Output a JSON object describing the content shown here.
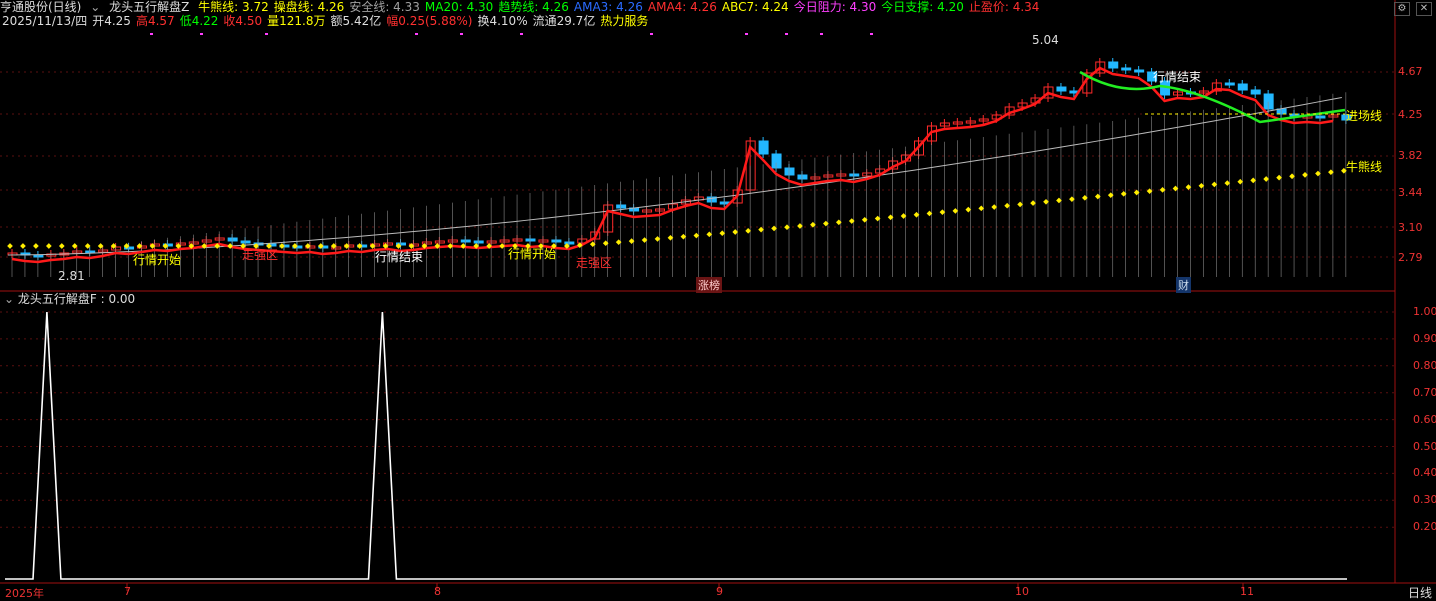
{
  "header": {
    "stock_title": "亨通股份(日线)",
    "indicator_title": "龙头五行解盘Z",
    "items": [
      {
        "label": "牛熊线: 3.72",
        "color": "#ffff00"
      },
      {
        "label": "操盘线: 4.26",
        "color": "#ffff00"
      },
      {
        "label": "安全线: 4.33",
        "color": "#a0a0a0"
      },
      {
        "label": "MA20: 4.30",
        "color": "#00ff00"
      },
      {
        "label": "趋势线: 4.26",
        "color": "#00ff00"
      },
      {
        "label": "AMA3: 4.26",
        "color": "#2a6bff"
      },
      {
        "label": "AMA4: 4.26",
        "color": "#ff3030"
      },
      {
        "label": "ABC7: 4.24",
        "color": "#ffff00"
      },
      {
        "label": "今日阻力: 4.30",
        "color": "#ff40ff"
      },
      {
        "label": "今日支撑: 4.20",
        "color": "#00ff00"
      },
      {
        "label": "止盈价: 4.34",
        "color": "#ff3030"
      }
    ],
    "row2": [
      {
        "label": "2025/11/13/四",
        "color": "#dddddd"
      },
      {
        "label": "开4.25",
        "color": "#dddddd"
      },
      {
        "label": "高4.57",
        "color": "#ff3030"
      },
      {
        "label": "低4.22",
        "color": "#00ff00"
      },
      {
        "label": "收4.50",
        "color": "#ff3030"
      },
      {
        "label": "量121.8万",
        "color": "#ffff00"
      },
      {
        "label": "额5.42亿",
        "color": "#dddddd"
      },
      {
        "label": "幅0.25(5.88%)",
        "color": "#ff3030"
      },
      {
        "label": "换4.10%",
        "color": "#dddddd"
      },
      {
        "label": "流通29.7亿",
        "color": "#dddddd"
      },
      {
        "label": "热力服务",
        "color": "#ffff00"
      }
    ]
  },
  "price_axis": [
    "4.67",
    "4.25",
    "3.82",
    "3.44",
    "3.10",
    "2.79"
  ],
  "price_annotations": {
    "high": "5.04",
    "low": "2.81",
    "start1": "行情开始",
    "end1": "行情结束",
    "start2": "行情开始",
    "end2": "行情结束",
    "strong1": "走强区",
    "strong2": "走强区",
    "entry_line": "进场线",
    "bull_line": "牛熊线",
    "tag_limitup": "涨榜",
    "tag_finance": "财"
  },
  "sub_panel": {
    "title": "龙头五行解盘F : 0.00",
    "axis": [
      "1.00",
      "0.90",
      "0.80",
      "0.70",
      "0.60",
      "0.50",
      "0.40",
      "0.30",
      "0.20"
    ]
  },
  "date_axis": [
    "2025年",
    "7",
    "8",
    "9",
    "10",
    "11"
  ],
  "period_label": "日线",
  "chart_data": {
    "type": "line",
    "title": "龙头五行解盘F",
    "series": [
      {
        "name": "龙头五行解盘F",
        "values": [
          0,
          0,
          0,
          1,
          0,
          0,
          0,
          0,
          0,
          0,
          0,
          0,
          0,
          0,
          0,
          0,
          0,
          0,
          0,
          0,
          0,
          0,
          0,
          0,
          0,
          0,
          0,
          1,
          0,
          0,
          0,
          0,
          0,
          0,
          0,
          0,
          0,
          0,
          0,
          0,
          0,
          0,
          0,
          0,
          0,
          0,
          0,
          0,
          0,
          0,
          0,
          0,
          0,
          0,
          0,
          0,
          0,
          0,
          0,
          0,
          0,
          0,
          0,
          0,
          0,
          0,
          0,
          0,
          0,
          0,
          0,
          0,
          0,
          0,
          0,
          0,
          0,
          0,
          0,
          0,
          0,
          0,
          0,
          0,
          0,
          0,
          0,
          0,
          0,
          0,
          0,
          0,
          0,
          0,
          0,
          0,
          0
        ]
      }
    ],
    "ylim": [
      0,
      1.0
    ]
  }
}
